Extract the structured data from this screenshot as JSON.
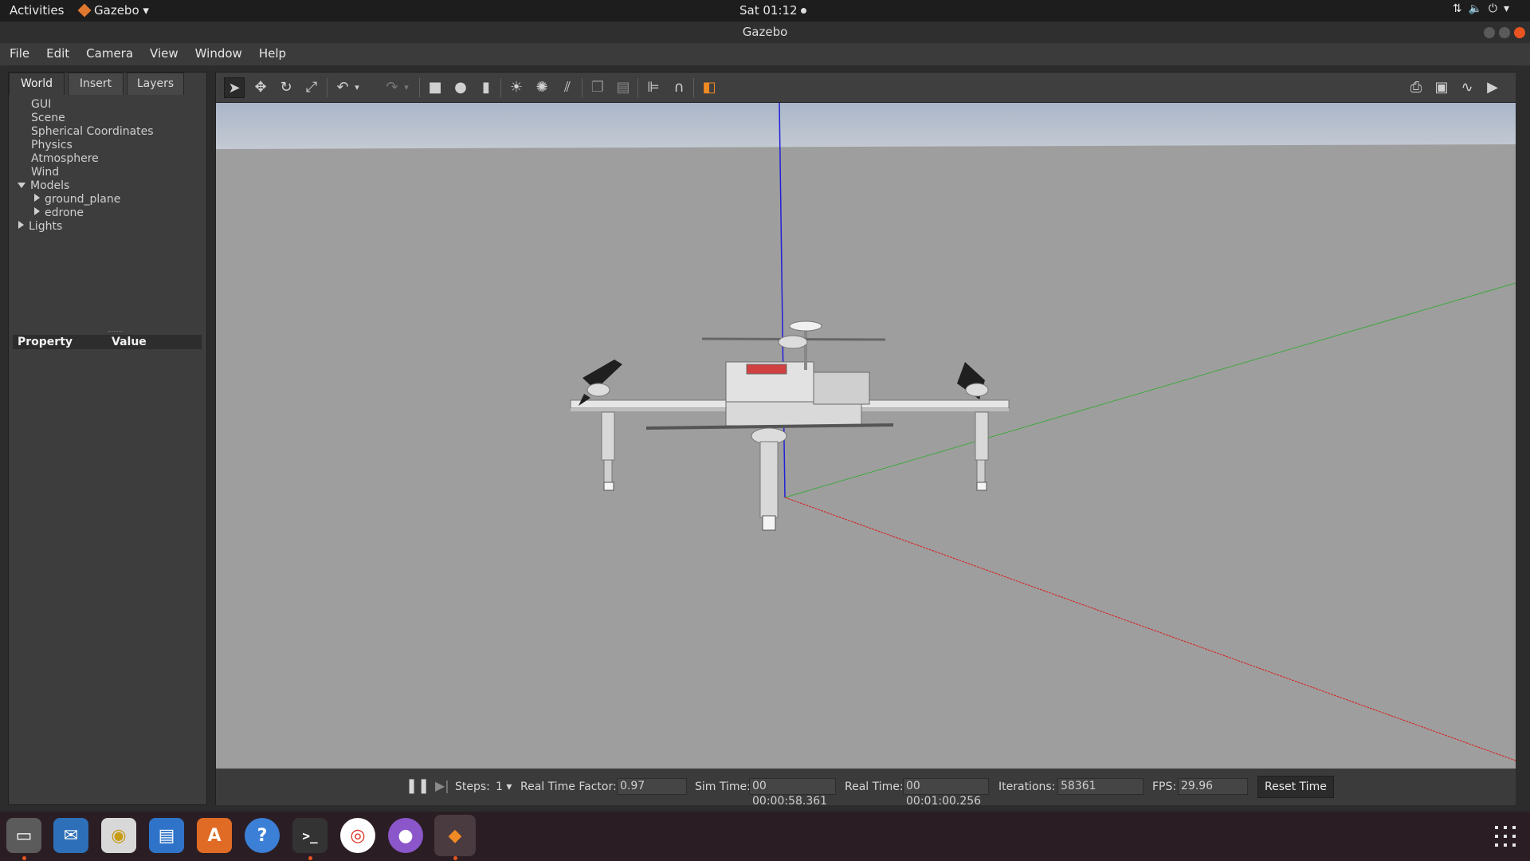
{
  "topbar": {
    "activities": "Activities",
    "app": "Gazebo",
    "clock": "Sat 01:12"
  },
  "window": {
    "title": "Gazebo"
  },
  "menu": [
    "File",
    "Edit",
    "Camera",
    "View",
    "Window",
    "Help"
  ],
  "tabs": [
    "World",
    "Insert",
    "Layers"
  ],
  "tree": {
    "gui": "GUI",
    "scene": "Scene",
    "spherical": "Spherical Coordinates",
    "physics": "Physics",
    "atmosphere": "Atmosphere",
    "wind": "Wind",
    "models": "Models",
    "ground_plane": "ground_plane",
    "edrone": "edrone",
    "lights": "Lights"
  },
  "properties": {
    "property": "Property",
    "value": "Value"
  },
  "status": {
    "steps_label": "Steps:",
    "steps_value": "1",
    "rtf_label": "Real Time Factor:",
    "rtf_value": "0.97",
    "simtime_label": "Sim Time:",
    "simtime_value": "00 00:00:58.361",
    "realtime_label": "Real Time:",
    "realtime_value": "00 00:01:00.256",
    "iterations_label": "Iterations:",
    "iterations_value": "58361",
    "fps_label": "FPS:",
    "fps_value": "29.96",
    "reset_label": "Reset Time"
  }
}
